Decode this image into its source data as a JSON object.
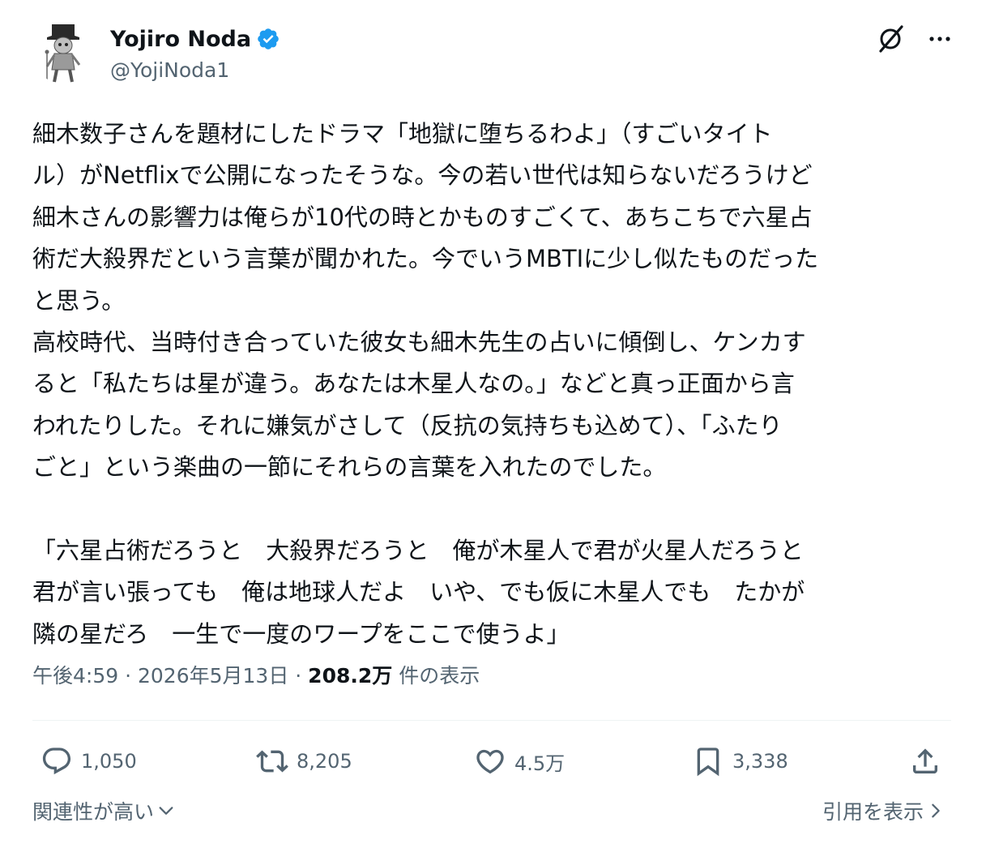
{
  "author": {
    "display_name": "Yojiro Noda",
    "handle": "@YojiNoda1",
    "verified": true
  },
  "tweet": {
    "text": "細木数子さんを題材にしたドラマ「地獄に堕ちるわよ」（すごいタイト\nル）がNetflixで公開になったそうな。今の若い世代は知らないだろうけど\n細木さんの影響力は俺らが10代の時とかものすごくて、あちこちで六星占\n術だ大殺界だという言葉が聞かれた。今でいうMBTIに少し似たものだった\nと思う。\n高校時代、当時付き合っていた彼女も細木先生の占いに傾倒し、ケンカす\nると「私たちは星が違う。あなたは木星人なの。」などと真っ正面から言\nわれたりした。それに嫌気がさして（反抗の気持ちも込めて）、「ふたり\nごと」という楽曲の一節にそれらの言葉を入れたのでした。\n\n「六星占術だろうと　大殺界だろうと　俺が木星人で君が火星人だろうと\n君が言い張っても　俺は地球人だよ　いや、でも仮に木星人でも　たかが\n隣の星だろ　一生で一度のワープをここで使うよ」"
  },
  "meta": {
    "time": "午後4:59",
    "separator": " · ",
    "date": "2026年5月13日",
    "views_count": "208.2万",
    "views_label": " 件の表示"
  },
  "actions": {
    "replies": "1,050",
    "reposts": "8,205",
    "likes": "4.5万",
    "bookmarks": "3,338"
  },
  "footer": {
    "sort_label": "関連性が高い",
    "quotes_label": "引用を表示"
  },
  "colors": {
    "text": "#0f1419",
    "secondary": "#536471",
    "verified_blue": "#1d9bf0",
    "divider": "#eff3f4"
  },
  "icons": [
    "grok-icon",
    "more-icon",
    "reply-icon",
    "repost-icon",
    "like-icon",
    "bookmark-icon",
    "share-icon",
    "chevron-down-icon",
    "chevron-right-icon",
    "verified-badge-icon"
  ]
}
